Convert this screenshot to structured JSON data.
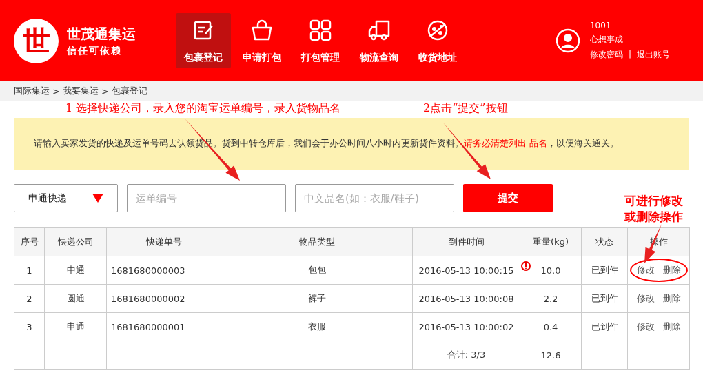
{
  "brand": {
    "name": "世茂通集运",
    "slogan": "信任可依赖",
    "logo_char": "世"
  },
  "nav": [
    {
      "label": "包裹登记",
      "selected": true
    },
    {
      "label": "申请打包",
      "selected": false
    },
    {
      "label": "打包管理",
      "selected": false
    },
    {
      "label": "物流查询",
      "selected": false
    },
    {
      "label": "收货地址",
      "selected": false
    }
  ],
  "user": {
    "id": "1001",
    "nickname": "心想事成",
    "change_password": "修改密码",
    "separator": "|",
    "logout": "退出账号"
  },
  "breadcrumb": [
    "国际集运",
    ">",
    "我要集运",
    ">",
    "包裹登记"
  ],
  "notice": {
    "text": "请输入卖家发货的快递及运单号码去认领货品。货到中转仓库后，我们会于办公时间八小时内更新货件资料。",
    "highlight": "请务必清楚列出 品名",
    "tail": "，以便海关通关。"
  },
  "form": {
    "courier": "申通快递",
    "tracking_placeholder": "运单编号",
    "item_placeholder": "中文品名(如：衣服/鞋子)",
    "submit": "提交"
  },
  "table": {
    "columns": [
      "序号",
      "快递公司",
      "快递单号",
      "物品类型",
      "到件时间",
      "重量(kg)",
      "状态",
      "操作"
    ],
    "rows": [
      {
        "no": "1",
        "courier": "中通",
        "tracking": "1681680000003",
        "item": "包包",
        "time": "2016-05-13 10:00:15",
        "weight": "10.0",
        "status": "已到件",
        "edit": "修改",
        "delete": "删除",
        "flagged": true,
        "circled": true
      },
      {
        "no": "2",
        "courier": "圆通",
        "tracking": "1681680000002",
        "item": "裤子",
        "time": "2016-05-13 10:00:08",
        "weight": "2.2",
        "status": "已到件",
        "edit": "修改",
        "delete": "删除",
        "flagged": false,
        "circled": false
      },
      {
        "no": "3",
        "courier": "申通",
        "tracking": "1681680000001",
        "item": "衣服",
        "time": "2016-05-13 10:00:02",
        "weight": "0.4",
        "status": "已到件",
        "edit": "修改",
        "delete": "删除",
        "flagged": false,
        "circled": false
      }
    ],
    "total": {
      "label": "合计: 3/3",
      "weight": "12.6"
    }
  },
  "annotations": {
    "step_1": "1 选择快递公司，录入您的淘宝运单编号，录入货物品名",
    "step_2": "2点击“提交”按钮",
    "action_note": "可进行修改或删除操作"
  }
}
